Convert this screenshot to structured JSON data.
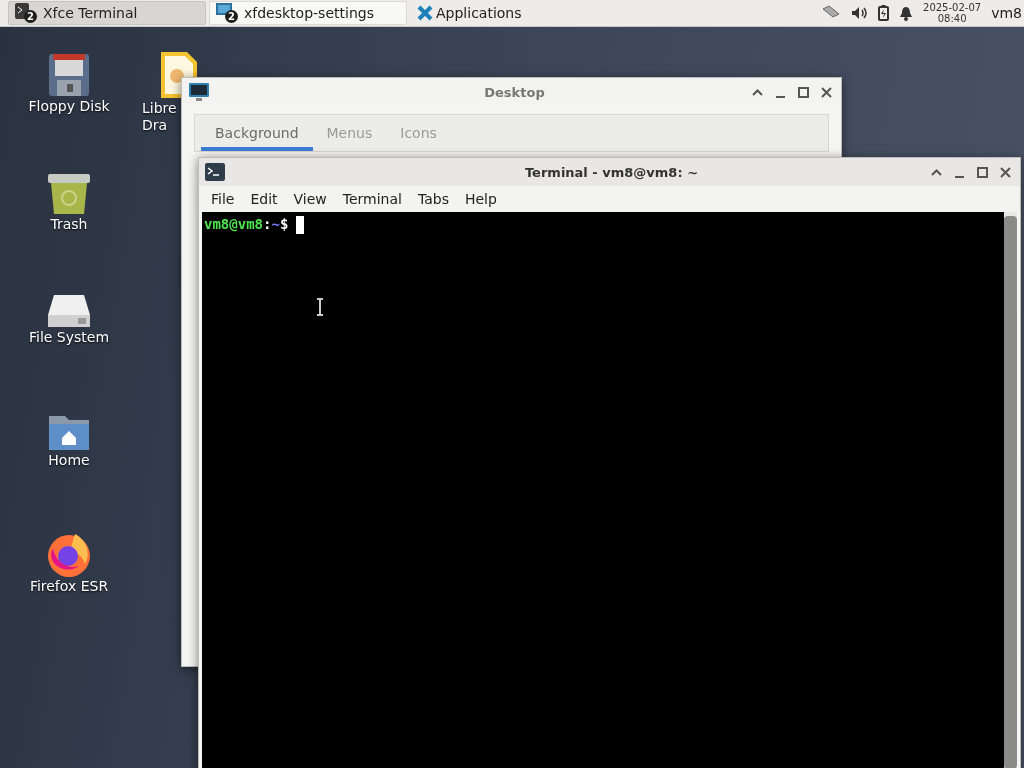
{
  "taskbar": {
    "tasks": [
      {
        "label": "Xfce Terminal",
        "badge": "2",
        "kind": "terminal",
        "selected": true
      },
      {
        "label": "xfdesktop-settings",
        "badge": "2",
        "kind": "settings",
        "selected": false
      }
    ],
    "applications": "Applications",
    "date": "2025-02-07",
    "time": "08:40",
    "user": "vm8"
  },
  "desktop_icons": [
    {
      "kind": "floppy",
      "lines": [
        "Floppy Disk"
      ]
    },
    {
      "kind": "draw",
      "lines": [
        "Libre",
        "Dra"
      ]
    },
    {
      "kind": "trash",
      "lines": [
        "Trash"
      ]
    },
    {
      "kind": "drive",
      "lines": [
        "File System"
      ]
    },
    {
      "kind": "home",
      "lines": [
        "Home"
      ]
    },
    {
      "kind": "firefox",
      "lines": [
        "Firefox ESR"
      ]
    }
  ],
  "settings_window": {
    "title": "Desktop",
    "tabs": [
      {
        "label": "Background",
        "selected": true
      },
      {
        "label": "Menus",
        "selected": false
      },
      {
        "label": "Icons",
        "selected": false
      }
    ]
  },
  "terminal_window": {
    "title": "Terminal - vm8@vm8: ~",
    "menu": [
      "File",
      "Edit",
      "View",
      "Terminal",
      "Tabs",
      "Help"
    ],
    "prompt": {
      "user_host": "vm8@vm8",
      "separator": ":",
      "path": "~",
      "symbol": "$"
    }
  }
}
